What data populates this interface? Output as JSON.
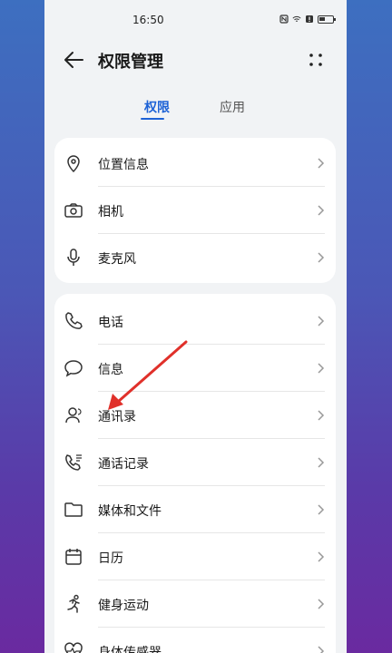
{
  "status_bar": {
    "time": "16:50"
  },
  "header": {
    "title": "权限管理"
  },
  "tabs": [
    {
      "label": "权限",
      "active": true
    },
    {
      "label": "应用",
      "active": false
    }
  ],
  "group1": [
    {
      "label": "位置信息",
      "icon": "location-pin-icon"
    },
    {
      "label": "相机",
      "icon": "camera-icon"
    },
    {
      "label": "麦克风",
      "icon": "microphone-icon"
    }
  ],
  "group2": [
    {
      "label": "电话",
      "icon": "phone-icon"
    },
    {
      "label": "信息",
      "icon": "message-icon"
    },
    {
      "label": "通讯录",
      "icon": "contacts-icon"
    },
    {
      "label": "通话记录",
      "icon": "call-log-icon"
    },
    {
      "label": "媒体和文件",
      "icon": "folder-icon"
    },
    {
      "label": "日历",
      "icon": "calendar-icon"
    },
    {
      "label": "健身运动",
      "icon": "running-icon"
    },
    {
      "label": "身体传感器",
      "icon": "heart-sensor-icon"
    }
  ],
  "colors": {
    "accent": "#1d62d6",
    "annotation_arrow": "#e0302a"
  }
}
